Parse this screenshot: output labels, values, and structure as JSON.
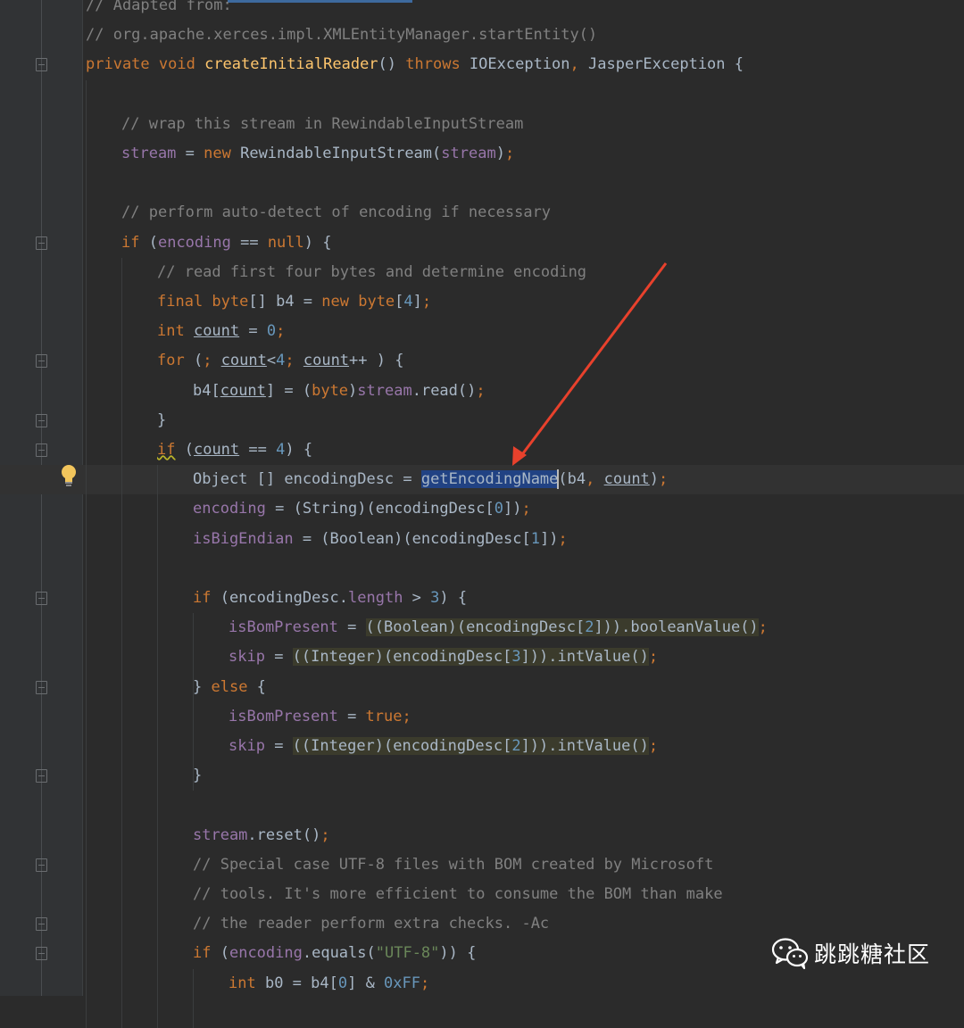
{
  "editor": {
    "language": "java",
    "lines": [
      {
        "indent": 0,
        "fold": "none",
        "tokens": [
          {
            "t": "// Adapted from:",
            "c": "cm"
          }
        ]
      },
      {
        "indent": 0,
        "fold": "none",
        "tokens": [
          {
            "t": "// org.apache.xerces.impl.XMLEntityManager.startEntity()",
            "c": "cm"
          }
        ]
      },
      {
        "indent": 0,
        "fold": "open",
        "tokens": [
          {
            "t": "private ",
            "c": "kw"
          },
          {
            "t": "void ",
            "c": "kw"
          },
          {
            "t": "createInitialReader",
            "c": "fn"
          },
          {
            "t": "() "
          },
          {
            "t": "throws ",
            "c": "kw"
          },
          {
            "t": "IOException"
          },
          {
            "t": ", ",
            "c": "kw"
          },
          {
            "t": "JasperException {"
          }
        ]
      },
      {
        "indent": 0,
        "fold": "none",
        "tokens": []
      },
      {
        "indent": 1,
        "fold": "none",
        "tokens": [
          {
            "t": "// wrap this stream in RewindableInputStream",
            "c": "cm"
          }
        ]
      },
      {
        "indent": 1,
        "fold": "none",
        "tokens": [
          {
            "t": "stream",
            "c": "field"
          },
          {
            "t": " = "
          },
          {
            "t": "new ",
            "c": "kw"
          },
          {
            "t": "RewindableInputStream("
          },
          {
            "t": "stream",
            "c": "field"
          },
          {
            "t": ")"
          },
          {
            "t": ";",
            "c": "kw"
          }
        ]
      },
      {
        "indent": 0,
        "fold": "none",
        "tokens": []
      },
      {
        "indent": 1,
        "fold": "none",
        "tokens": [
          {
            "t": "// perform auto-detect of encoding if necessary",
            "c": "cm"
          }
        ]
      },
      {
        "indent": 1,
        "fold": "open",
        "tokens": [
          {
            "t": "if ",
            "c": "kw"
          },
          {
            "t": "("
          },
          {
            "t": "encoding",
            "c": "field"
          },
          {
            "t": " == "
          },
          {
            "t": "null",
            "c": "kw"
          },
          {
            "t": ") {"
          }
        ]
      },
      {
        "indent": 2,
        "fold": "none",
        "tokens": [
          {
            "t": "// read first four bytes and determine encoding",
            "c": "cm"
          }
        ]
      },
      {
        "indent": 2,
        "fold": "none",
        "tokens": [
          {
            "t": "final ",
            "c": "kw"
          },
          {
            "t": "byte",
            "c": "kw"
          },
          {
            "t": "[] b4 = "
          },
          {
            "t": "new ",
            "c": "kw"
          },
          {
            "t": "byte",
            "c": "kw"
          },
          {
            "t": "["
          },
          {
            "t": "4",
            "c": "num"
          },
          {
            "t": "]"
          },
          {
            "t": ";",
            "c": "kw"
          }
        ]
      },
      {
        "indent": 2,
        "fold": "none",
        "tokens": [
          {
            "t": "int ",
            "c": "kw"
          },
          {
            "t": "count",
            "c": "u"
          },
          {
            "t": " = "
          },
          {
            "t": "0",
            "c": "num"
          },
          {
            "t": ";",
            "c": "kw"
          }
        ]
      },
      {
        "indent": 2,
        "fold": "open",
        "tokens": [
          {
            "t": "for ",
            "c": "kw"
          },
          {
            "t": "("
          },
          {
            "t": "; ",
            "c": "kw"
          },
          {
            "t": "count",
            "c": "u"
          },
          {
            "t": "<"
          },
          {
            "t": "4",
            "c": "num"
          },
          {
            "t": "; ",
            "c": "kw"
          },
          {
            "t": "count",
            "c": "u"
          },
          {
            "t": "++ ) {"
          }
        ]
      },
      {
        "indent": 3,
        "fold": "none",
        "tokens": [
          {
            "t": "b4["
          },
          {
            "t": "count",
            "c": "u"
          },
          {
            "t": "] = ("
          },
          {
            "t": "byte",
            "c": "kw"
          },
          {
            "t": ")"
          },
          {
            "t": "stream",
            "c": "field"
          },
          {
            "t": ".read()"
          },
          {
            "t": ";",
            "c": "kw"
          }
        ]
      },
      {
        "indent": 2,
        "fold": "close",
        "tokens": [
          {
            "t": "}"
          }
        ]
      },
      {
        "indent": 2,
        "fold": "open",
        "tokens": [
          {
            "t": "if",
            "c": "kwwavy"
          },
          {
            "t": " ("
          },
          {
            "t": "count",
            "c": "u"
          },
          {
            "t": " == "
          },
          {
            "t": "4",
            "c": "num"
          },
          {
            "t": ") {"
          }
        ]
      },
      {
        "indent": 3,
        "fold": "none",
        "current": true,
        "tokens": [
          {
            "t": "Object [] encodingDesc = "
          },
          {
            "t": "getEncodingName",
            "c": "sel"
          },
          {
            "t": "(b4"
          },
          {
            "t": ", ",
            "c": "kw"
          },
          {
            "t": "count",
            "c": "u"
          },
          {
            "t": ")"
          },
          {
            "t": ";",
            "c": "kw"
          }
        ]
      },
      {
        "indent": 3,
        "fold": "none",
        "tokens": [
          {
            "t": "encoding",
            "c": "field"
          },
          {
            "t": " = (String)(encodingDesc["
          },
          {
            "t": "0",
            "c": "num"
          },
          {
            "t": "])"
          },
          {
            "t": ";",
            "c": "kw"
          }
        ]
      },
      {
        "indent": 3,
        "fold": "none",
        "tokens": [
          {
            "t": "isBigEndian",
            "c": "field"
          },
          {
            "t": " = (Boolean)(encodingDesc["
          },
          {
            "t": "1",
            "c": "num"
          },
          {
            "t": "])"
          },
          {
            "t": ";",
            "c": "kw"
          }
        ]
      },
      {
        "indent": 0,
        "fold": "none",
        "tokens": []
      },
      {
        "indent": 3,
        "fold": "open",
        "tokens": [
          {
            "t": "if ",
            "c": "kw"
          },
          {
            "t": "(encodingDesc."
          },
          {
            "t": "length",
            "c": "field"
          },
          {
            "t": " > "
          },
          {
            "t": "3",
            "c": "num"
          },
          {
            "t": ") {"
          }
        ]
      },
      {
        "indent": 4,
        "fold": "none",
        "tokens": [
          {
            "t": "isBomPresent",
            "c": "field"
          },
          {
            "t": " = "
          },
          {
            "t": "((Boolean)(encodingDesc[",
            "c": "hl"
          },
          {
            "t": "2",
            "c": "hlnum"
          },
          {
            "t": "])).booleanValue()",
            "c": "hl"
          },
          {
            "t": ";",
            "c": "kw"
          }
        ]
      },
      {
        "indent": 4,
        "fold": "none",
        "tokens": [
          {
            "t": "skip",
            "c": "field"
          },
          {
            "t": " = "
          },
          {
            "t": "((Integer)(encodingDesc[",
            "c": "hl"
          },
          {
            "t": "3",
            "c": "hlnum"
          },
          {
            "t": "])).intValue()",
            "c": "hl"
          },
          {
            "t": ";",
            "c": "kw"
          }
        ]
      },
      {
        "indent": 3,
        "fold": "close",
        "tokens": [
          {
            "t": "} "
          },
          {
            "t": "else ",
            "c": "kw"
          },
          {
            "t": "{"
          }
        ]
      },
      {
        "indent": 4,
        "fold": "none",
        "tokens": [
          {
            "t": "isBomPresent",
            "c": "field"
          },
          {
            "t": " = "
          },
          {
            "t": "true",
            "c": "kw"
          },
          {
            "t": ";",
            "c": "kw"
          }
        ]
      },
      {
        "indent": 4,
        "fold": "none",
        "tokens": [
          {
            "t": "skip",
            "c": "field"
          },
          {
            "t": " = "
          },
          {
            "t": "((Integer)(encodingDesc[",
            "c": "hl"
          },
          {
            "t": "2",
            "c": "hlnum"
          },
          {
            "t": "])).intValue()",
            "c": "hl"
          },
          {
            "t": ";",
            "c": "kw"
          }
        ]
      },
      {
        "indent": 3,
        "fold": "close",
        "tokens": [
          {
            "t": "}"
          }
        ]
      },
      {
        "indent": 0,
        "fold": "none",
        "tokens": []
      },
      {
        "indent": 3,
        "fold": "none",
        "tokens": [
          {
            "t": "stream",
            "c": "field"
          },
          {
            "t": ".reset()"
          },
          {
            "t": ";",
            "c": "kw"
          }
        ]
      },
      {
        "indent": 3,
        "fold": "open",
        "tokens": [
          {
            "t": "// Special case UTF-8 files with BOM created by Microsoft",
            "c": "cm"
          }
        ]
      },
      {
        "indent": 3,
        "fold": "none",
        "tokens": [
          {
            "t": "// tools. It's more efficient to consume the BOM than make",
            "c": "cm"
          }
        ]
      },
      {
        "indent": 3,
        "fold": "close",
        "tokens": [
          {
            "t": "// the reader perform extra checks. -Ac",
            "c": "cm"
          }
        ]
      },
      {
        "indent": 3,
        "fold": "open",
        "tokens": [
          {
            "t": "if ",
            "c": "kw"
          },
          {
            "t": "("
          },
          {
            "t": "encoding",
            "c": "field"
          },
          {
            "t": ".equals("
          },
          {
            "t": "\"UTF-8\"",
            "c": "str"
          },
          {
            "t": ")) {"
          }
        ]
      },
      {
        "indent": 4,
        "fold": "none",
        "tokens": [
          {
            "t": "int ",
            "c": "kw"
          },
          {
            "t": "b0 = b4["
          },
          {
            "t": "0",
            "c": "num"
          },
          {
            "t": "] & "
          },
          {
            "t": "0xFF",
            "c": "num"
          },
          {
            "t": ";",
            "c": "kw"
          }
        ]
      }
    ]
  },
  "icons": {
    "lightbulb": "lightbulb-icon",
    "fold": "fold-icon",
    "wechat": "wechat-icon"
  },
  "watermark": {
    "text": "跳跳糖社区"
  },
  "annotation": {
    "arrow_color": "#e8412c"
  },
  "colors": {
    "background": "#2b2b2b",
    "keyword": "#cc7832",
    "function": "#ffc66d",
    "number": "#6897bb",
    "string": "#6a8759",
    "comment": "#808080",
    "field": "#9876aa",
    "selection": "#214283",
    "highlight": "#3b3b2c"
  }
}
